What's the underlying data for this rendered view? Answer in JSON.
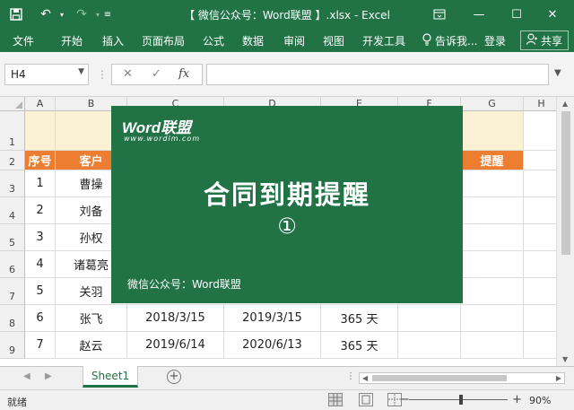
{
  "titlebar": {
    "title": "【 微信公众号：Word联盟 】.xlsx - Excel",
    "save_icon": "save-icon",
    "undo_icon": "undo-icon",
    "redo_icon": "redo-icon"
  },
  "ribbon": {
    "tabs": [
      "文件",
      "开始",
      "插入",
      "页面布局",
      "公式",
      "数据",
      "审阅",
      "视图",
      "开发工具"
    ],
    "tell_me": "告诉我...",
    "login": "登录",
    "share": "共享"
  },
  "formula_bar": {
    "name_box": "H4",
    "fx_label": "fx",
    "formula": ""
  },
  "columns": [
    "A",
    "B",
    "C",
    "D",
    "E",
    "F",
    "G",
    "H"
  ],
  "rows": [
    "1",
    "2",
    "3",
    "4",
    "5",
    "6",
    "7",
    "8",
    "9"
  ],
  "table": {
    "header_a": "序号",
    "header_b": "客户",
    "header_g": "提醒",
    "rows": [
      {
        "a": "1",
        "b": "曹操",
        "c": "",
        "d": "",
        "e": ""
      },
      {
        "a": "2",
        "b": "刘备",
        "c": "",
        "d": "",
        "e": ""
      },
      {
        "a": "3",
        "b": "孙权",
        "c": "",
        "d": "",
        "e": ""
      },
      {
        "a": "4",
        "b": "诸葛亮",
        "c": "",
        "d": "",
        "e": ""
      },
      {
        "a": "5",
        "b": "关羽",
        "c": "",
        "d": "",
        "e": ""
      },
      {
        "a": "6",
        "b": "张飞",
        "c": "2018/3/15",
        "d": "2019/3/15",
        "e": "365 天"
      },
      {
        "a": "7",
        "b": "赵云",
        "c": "2019/6/14",
        "d": "2020/6/13",
        "e": "365 天"
      }
    ]
  },
  "banner": {
    "logo": "Word联盟",
    "logo_url": "www.wordlm.com",
    "title": "合同到期提醒",
    "number": "①",
    "footer": "微信公众号：Word联盟",
    "bg_color": "#217346"
  },
  "sheets": {
    "active": "Sheet1"
  },
  "status": {
    "ready": "就绪",
    "zoom": "90%"
  },
  "colors": {
    "excel_green": "#217346",
    "header_orange": "#ed7d31",
    "row1_fill": "#fbf2d6"
  }
}
